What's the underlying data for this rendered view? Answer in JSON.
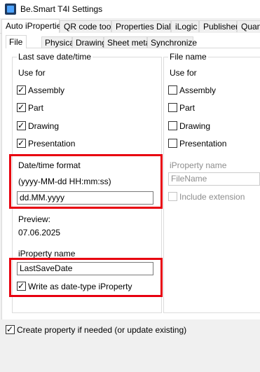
{
  "window": {
    "title": "Be.Smart T4I Settings"
  },
  "outer_tabs": [
    "Auto iProperties",
    "QR code tools",
    "Properties Dialog",
    "iLogic",
    "Publisher",
    "Quant"
  ],
  "inner_tabs": [
    "File",
    "Physical",
    "Drawing",
    "Sheet metal",
    "Synchronize"
  ],
  "last_save": {
    "group_title": "Last save date/time",
    "use_for_label": "Use for",
    "use_for": [
      {
        "label": "Assembly",
        "checked": true
      },
      {
        "label": "Part",
        "checked": true
      },
      {
        "label": "Drawing",
        "checked": true
      },
      {
        "label": "Presentation",
        "checked": true
      }
    ],
    "format_label": "Date/time format",
    "format_hint": "(yyyy-MM-dd HH:mm:ss)",
    "format_value": "dd.MM.yyyy",
    "preview_label": "Preview:",
    "preview_value": "07.06.2025",
    "iproperty_label": "iProperty name",
    "iproperty_value": "LastSaveDate",
    "date_type_label": "Write as date-type iProperty",
    "date_type_checked": true
  },
  "file_name": {
    "group_title": "File name",
    "use_for_label": "Use for",
    "use_for": [
      {
        "label": "Assembly",
        "checked": false
      },
      {
        "label": "Part",
        "checked": false
      },
      {
        "label": "Drawing",
        "checked": false
      },
      {
        "label": "Presentation",
        "checked": false
      }
    ],
    "iproperty_label": "iProperty name",
    "iproperty_value": "FileName",
    "include_ext_label": "Include extension",
    "include_ext_checked": false
  },
  "create_property": {
    "label": "Create property if needed (or update existing)",
    "checked": true
  },
  "colors": {
    "highlight": "#e8000f",
    "disabled_text": "#8d8d8d"
  }
}
